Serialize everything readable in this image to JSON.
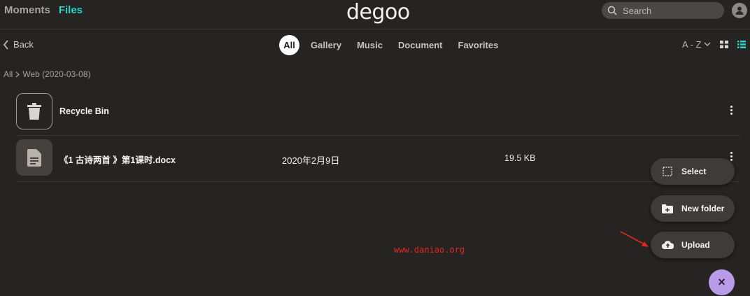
{
  "header": {
    "nav": {
      "moments": "Moments",
      "files": "Files"
    },
    "logo": "degoo",
    "search": {
      "placeholder": "Search"
    }
  },
  "toolbar": {
    "back": "Back",
    "filters": [
      "All",
      "Gallery",
      "Music",
      "Document",
      "Favorites"
    ],
    "active_filter": "All",
    "sort": "A - Z"
  },
  "breadcrumb": {
    "root": "All",
    "current": "Web (2020-03-08)"
  },
  "items": [
    {
      "name": "Recycle Bin",
      "icon": "trash-icon"
    },
    {
      "name": "《1 古诗两首 》第1课时.docx",
      "date": "2020年2月9日",
      "size": "19.5 KB",
      "icon": "document-icon"
    }
  ],
  "fab_menu": {
    "select": "Select",
    "new_folder": "New folder",
    "upload": "Upload",
    "close": "×"
  },
  "watermark": "www.daniao.org",
  "colors": {
    "accent": "#2fd3c8",
    "fab": "#b99be8",
    "background": "#262422",
    "watermark": "#e0261d"
  }
}
